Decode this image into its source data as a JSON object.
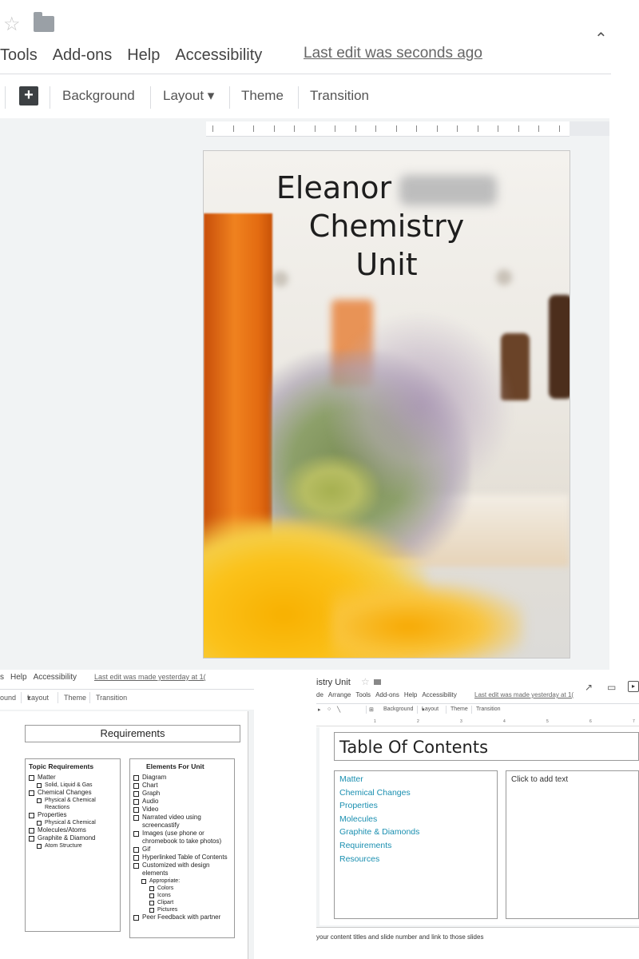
{
  "top": {
    "menu": [
      "Tools",
      "Add-ons",
      "Help",
      "Accessibility"
    ],
    "last_edit": "Last edit was seconds ago",
    "toolbar": {
      "background": "Background",
      "layout": "Layout",
      "theme": "Theme",
      "transition": "Transition"
    },
    "slide": {
      "title_line1": "Eleanor",
      "title_line2": "Chemistry",
      "title_line3": "Unit"
    }
  },
  "bottom_left": {
    "menu": [
      "s",
      "Help",
      "Accessibility"
    ],
    "last_edit": "Last edit was made yesterday at 1(",
    "toolbar": {
      "background": "ound",
      "layout": "Layout",
      "theme": "Theme",
      "transition": "Transition"
    },
    "title": "Requirements",
    "topic_header": "Topic Requirements",
    "topic_items": [
      {
        "text": "Matter",
        "level": 0
      },
      {
        "text": "Solid, Liquid & Gas",
        "level": 1
      },
      {
        "text": "Chemical Changes",
        "level": 0
      },
      {
        "text": "Physical & Chemical Reactions",
        "level": 1
      },
      {
        "text": "Properties",
        "level": 0
      },
      {
        "text": "Physical & Chemical",
        "level": 1
      },
      {
        "text": "Molecules/Atoms",
        "level": 0
      },
      {
        "text": "Graphite & Diamond",
        "level": 0
      },
      {
        "text": "Atom Structure",
        "level": 1
      }
    ],
    "elements_header": "Elements For Unit",
    "elements_items": [
      {
        "text": "Diagram",
        "level": 0
      },
      {
        "text": "Chart",
        "level": 0
      },
      {
        "text": "Graph",
        "level": 0
      },
      {
        "text": "Audio",
        "level": 0
      },
      {
        "text": "Video",
        "level": 0
      },
      {
        "text": "Narrated video using screencastify",
        "level": 0
      },
      {
        "text": "Images (use phone or chromebook to take photos)",
        "level": 0
      },
      {
        "text": "Gif",
        "level": 0
      },
      {
        "text": "Hyperlinked Table of Contents",
        "level": 0
      },
      {
        "text": "Customized with design elements",
        "level": 0
      },
      {
        "text": "Appropriate:",
        "level": 1
      },
      {
        "text": "Colors",
        "level": 2
      },
      {
        "text": "Icons",
        "level": 2
      },
      {
        "text": "Clipart",
        "level": 2
      },
      {
        "text": "Pictures",
        "level": 2
      },
      {
        "text": "Peer Feedback with partner",
        "level": 0
      }
    ]
  },
  "bottom_right": {
    "doc_title": "istry Unit",
    "menu": [
      "de",
      "Arrange",
      "Tools",
      "Add-ons",
      "Help",
      "Accessibility"
    ],
    "last_edit": "Last edit was made yesterday at 1(",
    "toolbar": {
      "background": "Background",
      "layout": "Layout",
      "theme": "Theme",
      "transition": "Transition"
    },
    "ruler_numbers": [
      "1",
      "2",
      "3",
      "4",
      "5",
      "6",
      "7"
    ],
    "toc_title": "Table Of Contents",
    "toc_links": [
      "Matter",
      "Chemical Changes",
      "Properties",
      "Molecules",
      "Graphite & Diamonds",
      "Requirements",
      "Resources"
    ],
    "placeholder": "Click to add text",
    "speaker_notes": "your content titles and slide number and link to those slides"
  },
  "colors": {
    "link": "#1a8fb0",
    "canvas": "#f1f3f4",
    "bottle_orange": "#e86a12"
  }
}
